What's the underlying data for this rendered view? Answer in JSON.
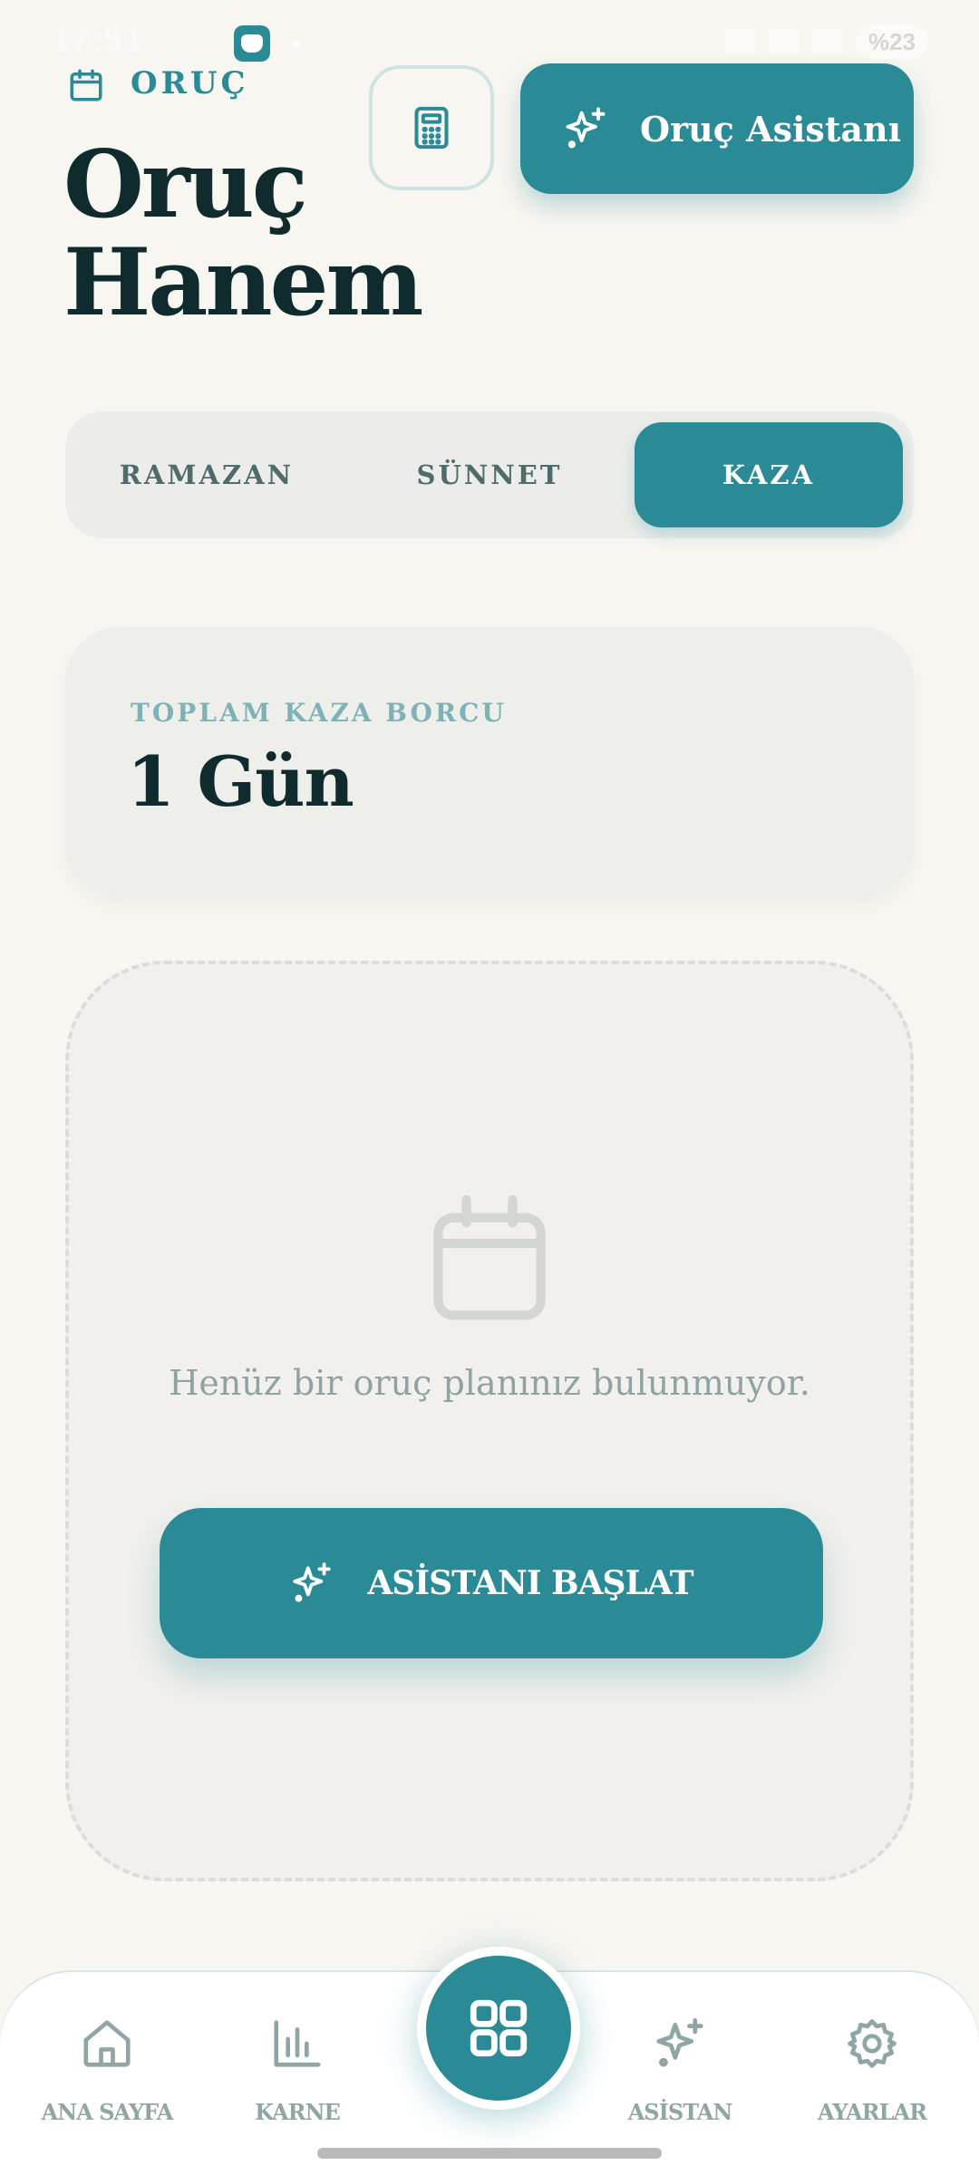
{
  "status_bar": {
    "time": "17:51",
    "battery": "%23"
  },
  "header": {
    "label": "ORUÇ",
    "title_line1": "Oruç",
    "title_line2": "Hanem",
    "assistant_button_label": "Oruç Asistanı"
  },
  "tabs": [
    {
      "label": "RAMAZAN",
      "selected": false
    },
    {
      "label": "SÜNNET",
      "selected": false
    },
    {
      "label": "KAZA",
      "selected": true
    }
  ],
  "debt_card": {
    "label": "TOPLAM KAZA BORCU",
    "value": "1 Gün"
  },
  "plan": {
    "empty_text": "Henüz bir oruç planınız bulunmuyor.",
    "start_button_label": "ASİSTANI BAŞLAT"
  },
  "bottom_nav": {
    "items": [
      {
        "label": "ANA SAYFA",
        "icon": "home-icon"
      },
      {
        "label": "KARNE",
        "icon": "bar-chart-icon"
      },
      {
        "label": "",
        "icon": "grid-icon"
      },
      {
        "label": "ASİSTAN",
        "icon": "sparkles-icon"
      },
      {
        "label": "AYARLAR",
        "icon": "gear-icon"
      }
    ]
  },
  "colors": {
    "accent": "#2a8a96",
    "background": "#f8f6f1",
    "text_dark": "#0f2b2d",
    "muted": "#8fa5a6"
  }
}
